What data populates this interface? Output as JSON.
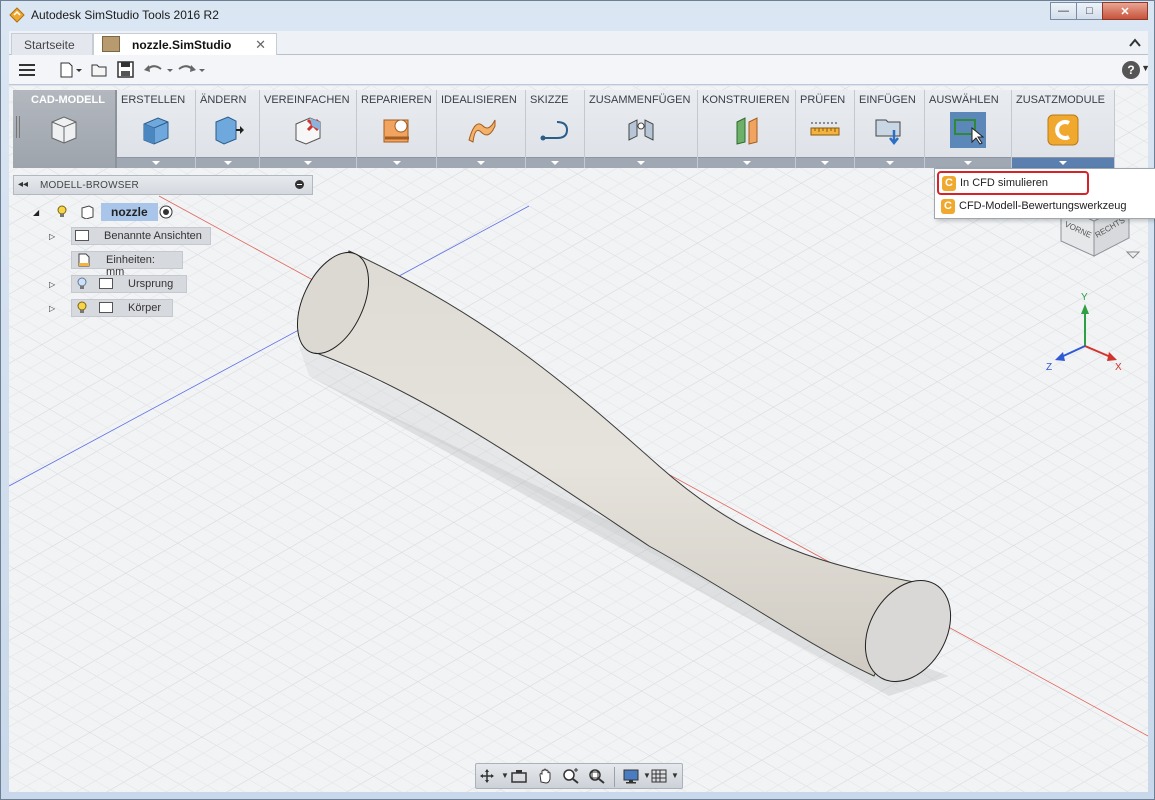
{
  "window": {
    "title": "Autodesk SimStudio Tools 2016 R2",
    "minimize_glyph": "—",
    "maximize_glyph": "□",
    "close_glyph": "✕"
  },
  "tabs": [
    {
      "label": "Startseite",
      "active": false
    },
    {
      "label": "nozzle.SimStudio",
      "active": true,
      "close_glyph": "✕"
    }
  ],
  "ribbon": {
    "workspace": "CAD-MODELL",
    "groups": [
      {
        "label": "ERSTELLEN",
        "icon": "box-icon"
      },
      {
        "label": "ÄNDERN",
        "icon": "modify-icon"
      },
      {
        "label": "VEREINFACHEN",
        "icon": "simplify-icon"
      },
      {
        "label": "REPARIEREN",
        "icon": "repair-icon"
      },
      {
        "label": "IDEALISIEREN",
        "icon": "idealize-icon"
      },
      {
        "label": "SKIZZE",
        "icon": "sketch-icon"
      },
      {
        "label": "ZUSAMMENFÜGEN",
        "icon": "joint-icon"
      },
      {
        "label": "KONSTRUIEREN",
        "icon": "construct-plane-icon"
      },
      {
        "label": "PRÜFEN",
        "icon": "measure-icon"
      },
      {
        "label": "EINFÜGEN",
        "icon": "insert-icon"
      },
      {
        "label": "AUSWÄHLEN",
        "icon": "select-icon"
      },
      {
        "label": "ZUSATZMODULE",
        "icon": "cfd-addin-icon"
      }
    ]
  },
  "browser": {
    "header": "MODELL-BROWSER",
    "root": "nozzle",
    "items": [
      {
        "label": "Benannte Ansichten",
        "expandable": true
      },
      {
        "label": "Einheiten: mm",
        "expandable": false
      },
      {
        "label": "Ursprung",
        "expandable": true
      },
      {
        "label": "Körper",
        "expandable": true
      }
    ]
  },
  "dropdown": {
    "items": [
      {
        "label": "In CFD simulieren",
        "highlighted": true
      },
      {
        "label": "CFD-Modell-Bewertungswerkzeug",
        "highlighted": false
      }
    ]
  },
  "viewcube": {
    "front": "VORNE",
    "right": "RECHTS"
  },
  "axes": {
    "x": "X",
    "y": "Y",
    "z": "Z"
  },
  "colors": {
    "accent_blue": "#5b7fae",
    "highlight_red": "#d6232a",
    "cfd_orange": "#f0a92e",
    "selection_blue": "#a9c6ea"
  }
}
